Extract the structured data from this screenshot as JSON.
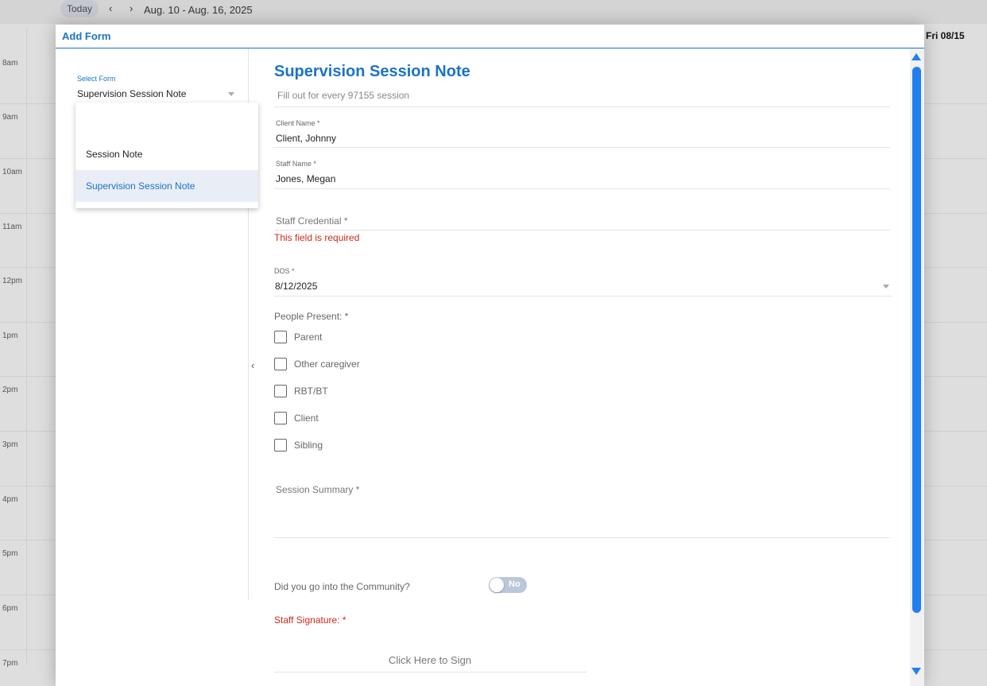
{
  "calendar": {
    "today_label": "Today",
    "prev_icon": "‹",
    "next_icon": "›",
    "date_range": "Aug. 10 - Aug. 16, 2025",
    "day_header": "Fri 08/15",
    "times": [
      "8am",
      "9am",
      "10am",
      "11am",
      "12pm",
      "1pm",
      "2pm",
      "3pm",
      "4pm",
      "5pm",
      "6pm",
      "7pm"
    ]
  },
  "modal": {
    "title": "Add Form"
  },
  "select_form": {
    "label": "Select Form",
    "value": "Supervision Session Note",
    "options": [
      "Session Note",
      "Supervision Session Note"
    ],
    "selected_index": 1
  },
  "form": {
    "title": "Supervision Session Note",
    "subtitle": "Fill out for every 97155 session",
    "client": {
      "label": "Client Name *",
      "value": "Client, Johnny"
    },
    "staff": {
      "label": "Staff Name *",
      "value": "Jones, Megan"
    },
    "credential": {
      "placeholder": "Staff Credential *",
      "error": "This field is required"
    },
    "dos": {
      "label": "DOS *",
      "value": "8/12/2025"
    },
    "people_present": {
      "label": "People Present: *",
      "options": [
        "Parent",
        "Other caregiver",
        "RBT/BT",
        "Client",
        "Sibling"
      ]
    },
    "summary": {
      "placeholder": "Session Summary *"
    },
    "community": {
      "label": "Did you go into the Community?",
      "toggle_text": "No"
    },
    "signature": {
      "label": "Staff Signature: *",
      "button": "Click Here to Sign"
    }
  },
  "colors": {
    "accent": "#1a73c8",
    "error": "#cc2a1a",
    "scrollbar": "#1f7ef0"
  }
}
